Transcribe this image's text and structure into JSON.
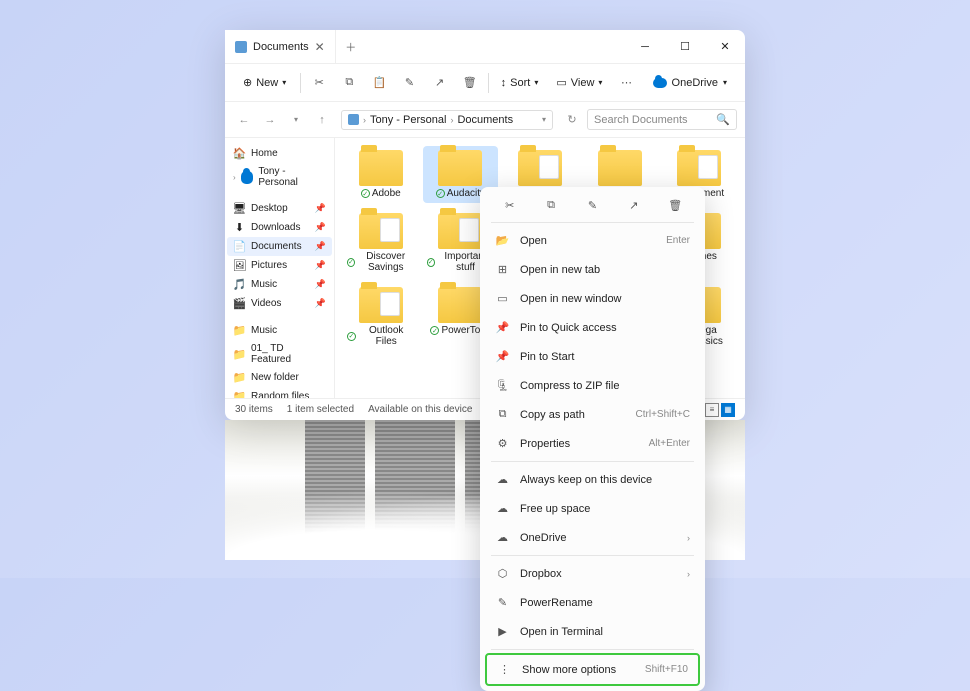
{
  "window": {
    "tab_title": "Documents",
    "new_label": "New",
    "sort_label": "Sort",
    "view_label": "View",
    "onedrive_label": "OneDrive",
    "breadcrumb": [
      "Tony - Personal",
      "Documents"
    ],
    "search_placeholder": "Search Documents"
  },
  "sidebar": {
    "home": "Home",
    "personal": "Tony - Personal",
    "pinned": [
      "Desktop",
      "Downloads",
      "Documents",
      "Pictures",
      "Music",
      "Videos"
    ],
    "extra": [
      "Music",
      "01_ TD Featured",
      "New folder",
      "Random files"
    ]
  },
  "folders": [
    {
      "name": "Adobe",
      "sync": true,
      "doc": false
    },
    {
      "name": "Audacity",
      "sync": true,
      "doc": false,
      "sel": true
    },
    {
      "name": "",
      "sync": false,
      "doc": true
    },
    {
      "name": "",
      "sync": false,
      "doc": false
    },
    {
      "name": "ver ment",
      "sync": true,
      "doc": true
    },
    {
      "name": "Discover Savings",
      "sync": true,
      "doc": true
    },
    {
      "name": "Important stuff",
      "sync": true,
      "doc": true
    },
    {
      "name": "",
      "sync": false,
      "doc": false
    },
    {
      "name": "",
      "sync": false,
      "doc": false
    },
    {
      "name": "ames",
      "sync": true,
      "doc": false
    },
    {
      "name": "Outlook Files",
      "sync": true,
      "doc": true
    },
    {
      "name": "PowerToys",
      "sync": true,
      "doc": false
    },
    {
      "name": "",
      "sync": false,
      "doc": false
    },
    {
      "name": "",
      "sync": false,
      "doc": false
    },
    {
      "name": "Mega Classics",
      "sync": true,
      "doc": false
    }
  ],
  "status": {
    "items": "30 items",
    "selected": "1 item selected",
    "avail": "Available on this device"
  },
  "context": {
    "open": "Open",
    "open_sc": "Enter",
    "newtab": "Open in new tab",
    "newwin": "Open in new window",
    "pinqa": "Pin to Quick access",
    "pinstart": "Pin to Start",
    "zip": "Compress to ZIP file",
    "copypath": "Copy as path",
    "copypath_sc": "Ctrl+Shift+C",
    "props": "Properties",
    "props_sc": "Alt+Enter",
    "always": "Always keep on this device",
    "freeup": "Free up space",
    "onedrive": "OneDrive",
    "dropbox": "Dropbox",
    "rename": "PowerRename",
    "terminal": "Open in Terminal",
    "more": "Show more options",
    "more_sc": "Shift+F10"
  }
}
